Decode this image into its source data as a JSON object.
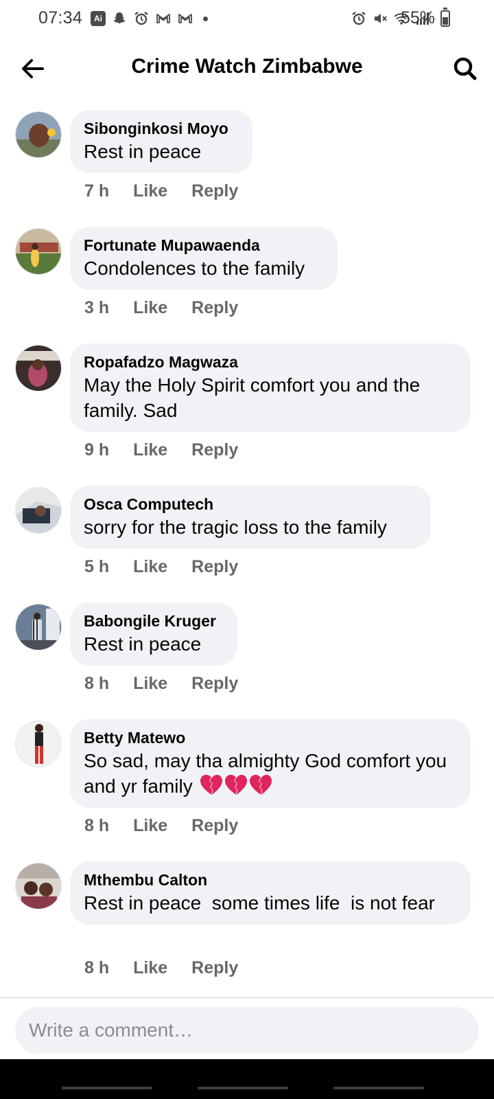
{
  "status_bar": {
    "time": "07:34",
    "left_icons": [
      "ai-icon",
      "snapchat-icon",
      "alarm-icon",
      "gmail-icon",
      "gmail-icon",
      "dot-icon"
    ],
    "right_icons": [
      "alarm-icon",
      "mute-icon",
      "wifi-icon",
      "signal-icon"
    ],
    "battery_percent_text": "55%",
    "battery_level": 0.55,
    "ai_badge": "Ai"
  },
  "header": {
    "title": "Crime Watch Zimbabwe",
    "back_icon": "arrow-left-icon",
    "search_icon": "search-icon"
  },
  "comments": [
    {
      "author": "Sibonginkosi Moyo",
      "text": "Rest in peace",
      "time": "7 h",
      "like": "Like",
      "reply": "Reply"
    },
    {
      "author": "Fortunate Mupawaenda",
      "text": "Condolences to the family",
      "time": "3 h",
      "like": "Like",
      "reply": "Reply"
    },
    {
      "author": "Ropafadzo Magwaza",
      "text": "May the Holy Spirit comfort you and the family. Sad",
      "time": "9 h",
      "like": "Like",
      "reply": "Reply"
    },
    {
      "author": "Osca Computech",
      "text": "sorry for the tragic loss to the family",
      "time": "5 h",
      "like": "Like",
      "reply": "Reply"
    },
    {
      "author": "Babongile Kruger",
      "text": "Rest in peace",
      "time": "8 h",
      "like": "Like",
      "reply": "Reply"
    },
    {
      "author": "Betty Matewo",
      "text": "So sad, may tha almighty God comfort you and yr family",
      "emoji_count": 3,
      "emoji": "broken-heart-icon",
      "time": "8 h",
      "like": "Like",
      "reply": "Reply"
    },
    {
      "author": "Mthembu Calton",
      "text": "Rest in peace  some times life  is not fear",
      "time": "8 h",
      "like": "Like",
      "reply": "Reply"
    }
  ],
  "composer": {
    "placeholder": "Write a comment…",
    "value": ""
  },
  "colors": {
    "bubble_bg": "#f0f2f5",
    "meta_text": "#65676b",
    "primary_text": "#050505",
    "emoji_red": "#e0245e"
  }
}
